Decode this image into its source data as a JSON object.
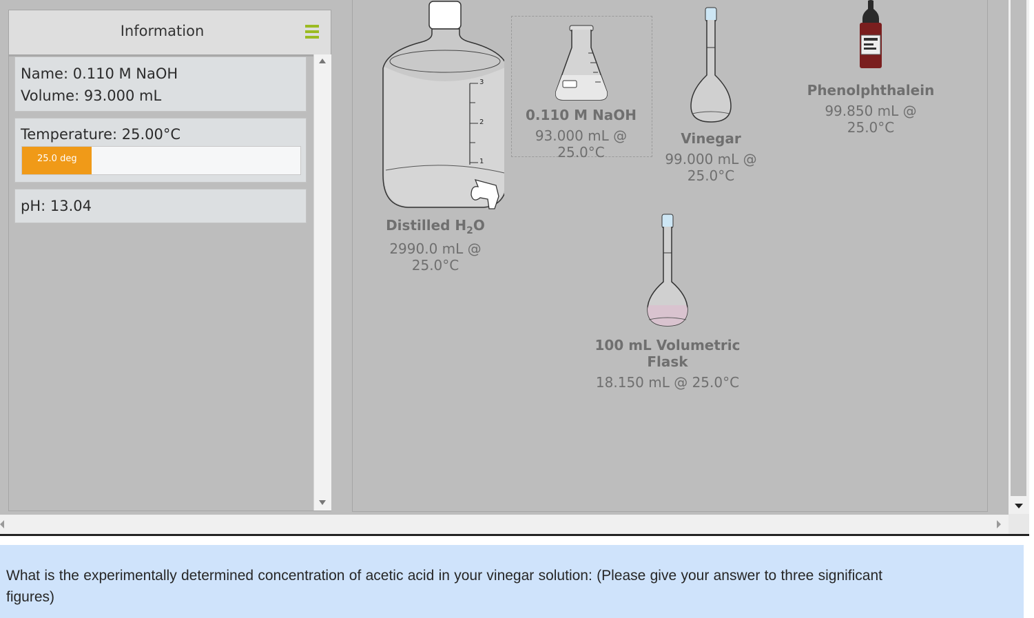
{
  "info_panel": {
    "title": "Information",
    "name_line": "Name: 0.110 M NaOH",
    "volume_line": "Volume: 93.000 mL",
    "temperature_line": "Temperature: 25.00°C",
    "temperature_bar_label": "25.0 deg",
    "temperature_bar_fraction": 0.25,
    "ph_line": "pH: 13.04"
  },
  "workspace": {
    "items": [
      {
        "id": "distilled-water",
        "name_prefix": "Distilled H",
        "name_sub": "2",
        "name_suffix": "O",
        "detail": "2990.0 mL @ 25.0°C"
      },
      {
        "id": "naoh-flask",
        "name": "0.110 M NaOH",
        "detail": "93.000 mL @ 25.0°C"
      },
      {
        "id": "vinegar",
        "name": "Vinegar",
        "detail": "99.000 mL @ 25.0°C"
      },
      {
        "id": "phenolphthalein",
        "name": "Phenolphthalein",
        "detail": "99.850 mL @ 25.0°C"
      },
      {
        "id": "volumetric-flask",
        "name": "100 mL Volumetric Flask",
        "detail": "18.150 mL @ 25.0°C"
      }
    ],
    "carboy_marks": [
      "3",
      "2",
      "1"
    ]
  },
  "question": {
    "text": "What is the experimentally determined concentration of acetic acid in your vinegar solution: (Please give your answer to three significant figures)"
  },
  "colors": {
    "temperature_fill": "#f09a18",
    "menu_icon": "#9bbb22",
    "question_bg": "#cfe3fb",
    "workspace_bg": "#bdbdbd"
  }
}
